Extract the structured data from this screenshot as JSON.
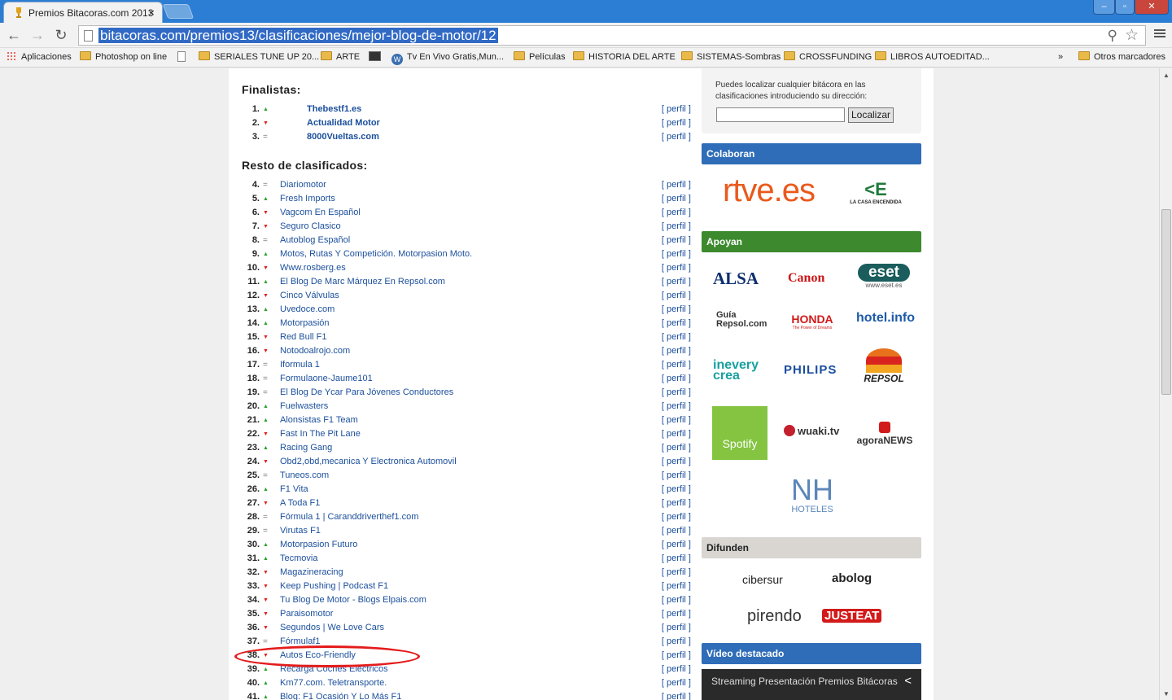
{
  "browser": {
    "tab_title": "Premios Bitacoras.com 2013",
    "tab_close": "×",
    "url": "bitacoras.com/premios13/clasificaciones/mejor-blog-de-motor/12",
    "window_controls": [
      "–",
      "▫",
      "✕"
    ],
    "nav": {
      "back": "←",
      "forward": "→",
      "reload": "↻"
    },
    "bookmarks": [
      {
        "label": "Aplicaciones",
        "icon": "apps-icon"
      },
      {
        "label": "Photoshop on line",
        "icon": "folder-icon"
      },
      {
        "label": "",
        "icon": "page-icon"
      },
      {
        "label": "SERIALES TUNE UP 20...",
        "icon": "folder-icon"
      },
      {
        "label": "ARTE",
        "icon": "folder-icon"
      },
      {
        "label": "",
        "icon": "media-icon"
      },
      {
        "label": "Tv En Vivo Gratis,Mun...",
        "icon": "wordpress-icon"
      },
      {
        "label": "Películas",
        "icon": "folder-icon"
      },
      {
        "label": "HISTORIA DEL ARTE",
        "icon": "folder-icon"
      },
      {
        "label": "SISTEMAS-Sombras",
        "icon": "folder-icon"
      },
      {
        "label": "CROSSFUNDING",
        "icon": "folder-icon"
      },
      {
        "label": "LIBROS AUTOEDITAD...",
        "icon": "folder-icon"
      }
    ],
    "bookmarks_more": "»",
    "other_bookmarks": "Otros marcadores"
  },
  "main": {
    "finalists_title": "Finalistas:",
    "rest_title": "Resto de clasificados:",
    "perfil_label": "[ perfil ]",
    "finalists": [
      {
        "n": "1.",
        "trend": "up",
        "name": "Thebestf1.es"
      },
      {
        "n": "2.",
        "trend": "down",
        "name": "Actualidad Motor"
      },
      {
        "n": "3.",
        "trend": "eq",
        "name": "8000Vueltas.com"
      }
    ],
    "rest": [
      {
        "n": "4.",
        "trend": "eq",
        "name": "Diariomotor"
      },
      {
        "n": "5.",
        "trend": "up",
        "name": "Fresh Imports"
      },
      {
        "n": "6.",
        "trend": "down",
        "name": "Vagcom En Español"
      },
      {
        "n": "7.",
        "trend": "down",
        "name": "Seguro Clasico"
      },
      {
        "n": "8.",
        "trend": "eq",
        "name": "Autoblog Español"
      },
      {
        "n": "9.",
        "trend": "up",
        "name": "Motos, Rutas Y Competición. Motorpasion Moto."
      },
      {
        "n": "10.",
        "trend": "down",
        "name": "Www.rosberg.es"
      },
      {
        "n": "11.",
        "trend": "up",
        "name": "El Blog De Marc Márquez En Repsol.com"
      },
      {
        "n": "12.",
        "trend": "down",
        "name": "Cinco Válvulas"
      },
      {
        "n": "13.",
        "trend": "up",
        "name": "Uvedoce.com"
      },
      {
        "n": "14.",
        "trend": "up",
        "name": "Motorpasión"
      },
      {
        "n": "15.",
        "trend": "down",
        "name": "Red Bull F1"
      },
      {
        "n": "16.",
        "trend": "down",
        "name": "Notodoalrojo.com"
      },
      {
        "n": "17.",
        "trend": "eq",
        "name": "Iformula 1"
      },
      {
        "n": "18.",
        "trend": "eq",
        "name": "Formulaone-Jaume101"
      },
      {
        "n": "19.",
        "trend": "eq",
        "name": "El Blog De Ycar Para Jóvenes Conductores"
      },
      {
        "n": "20.",
        "trend": "up",
        "name": "Fuelwasters"
      },
      {
        "n": "21.",
        "trend": "up",
        "name": "Alonsistas F1 Team"
      },
      {
        "n": "22.",
        "trend": "down",
        "name": "Fast In The Pit Lane"
      },
      {
        "n": "23.",
        "trend": "up",
        "name": "Racing Gang"
      },
      {
        "n": "24.",
        "trend": "down",
        "name": "Obd2,obd,mecanica Y Electronica Automovil"
      },
      {
        "n": "25.",
        "trend": "eq",
        "name": "Tuneos.com"
      },
      {
        "n": "26.",
        "trend": "up",
        "name": "F1 Vita"
      },
      {
        "n": "27.",
        "trend": "down",
        "name": "A Toda F1"
      },
      {
        "n": "28.",
        "trend": "eq",
        "name": "Fórmula 1 | Caranddriverthef1.com"
      },
      {
        "n": "29.",
        "trend": "eq",
        "name": "Virutas F1"
      },
      {
        "n": "30.",
        "trend": "up",
        "name": "Motorpasion Futuro"
      },
      {
        "n": "31.",
        "trend": "up",
        "name": "Tecmovia"
      },
      {
        "n": "32.",
        "trend": "down",
        "name": "Magazineracing"
      },
      {
        "n": "33.",
        "trend": "down",
        "name": "Keep Pushing | Podcast F1"
      },
      {
        "n": "34.",
        "trend": "down",
        "name": "Tu Blog De Motor - Blogs Elpais.com"
      },
      {
        "n": "35.",
        "trend": "down",
        "name": "Paraisomotor"
      },
      {
        "n": "36.",
        "trend": "down",
        "name": "Segundos | We Love Cars"
      },
      {
        "n": "37.",
        "trend": "eq",
        "name": "Fórmulaf1"
      },
      {
        "n": "38.",
        "trend": "down",
        "name": "Autos Eco-Friendly"
      },
      {
        "n": "39.",
        "trend": "up",
        "name": "Recarga Coches Electricos"
      },
      {
        "n": "40.",
        "trend": "up",
        "name": "Km77.com. Teletransporte."
      },
      {
        "n": "41.",
        "trend": "up",
        "name": "Blog: F1 Ocasión Y Lo Más F1"
      }
    ],
    "highlighted_row": "38."
  },
  "sidebar": {
    "locate_text": "Puedes localizar cualquier bitácora en las clasificaciones introduciendo su dirección:",
    "locate_button": "Localizar",
    "colaboran": "Colaboran",
    "apoyan": "Apoyan",
    "difunden": "Difunden",
    "video": "Vídeo destacado",
    "video_title": "Streaming Presentación Premios Bitácoras",
    "logos": {
      "rtve": "rtve.es",
      "casa_encendida": "LA CASA ENCENDIDA",
      "alsa": "ALSA",
      "canon": "Canon",
      "eset": "eset",
      "eset_url": "www.eset.es",
      "guia_repsol": "Guía Repsol.com",
      "honda": "HONDA",
      "honda_sub": "The Power of Dreams",
      "hotelinfo": "hotel.info",
      "inevery": "inevery crea",
      "philips": "PHILIPS",
      "repsol": "REPSOL",
      "spotify": "Spotify",
      "wuaki": "wuaki.tv",
      "agoranews": "agoraNEWS",
      "nh": "NH",
      "nh_sub": "HOTELES",
      "cibersur": "cibersur",
      "abolog": "abolog",
      "pirendo": "pirendo",
      "justeat": "JUSTEAT"
    }
  },
  "colors": {
    "link": "#1b4f9c",
    "up": "#27a327",
    "down": "#e02020",
    "header_blue": "#2f6db8",
    "header_green": "#3c8a2d",
    "highlight": "#e41b1b"
  }
}
